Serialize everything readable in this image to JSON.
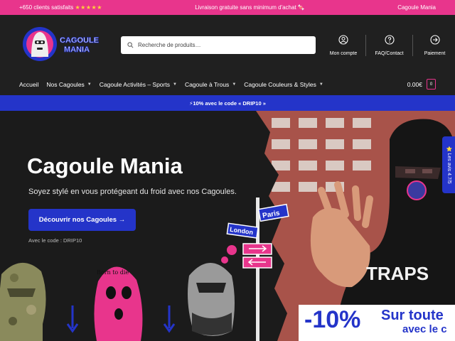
{
  "topbar": {
    "left_text": "+650 clients satisfaits",
    "stars": "★★★★★",
    "center_text": "Livraison gratuite sans minimum d'achat 🍬",
    "right_text": "Cagoule Mania"
  },
  "header": {
    "logo_text_line1": "CAGOULE",
    "logo_text_line2": "MANIA",
    "search_placeholder": "Recherche de produits…",
    "icons": [
      {
        "label": "Mon compte",
        "icon": "user-icon"
      },
      {
        "label": "FAQ/Contact",
        "icon": "help-icon"
      },
      {
        "label": "Paiement",
        "icon": "arrow-right-circle-icon"
      }
    ]
  },
  "nav": {
    "items": [
      {
        "label": "Accueil",
        "has_dropdown": false
      },
      {
        "label": "Nos Cagoules",
        "has_dropdown": true
      },
      {
        "label": "Cagoule Activités – Sports",
        "has_dropdown": true
      },
      {
        "label": "Cagoule à Trous",
        "has_dropdown": true
      },
      {
        "label": "Cagoule Couleurs & Styles",
        "has_dropdown": true
      }
    ],
    "cart_total": "0.00€",
    "cart_count": "0"
  },
  "promo": {
    "text": "⚡10% avec le code « DRIP10 »"
  },
  "hero": {
    "title": "Cagoule Mania",
    "subtitle": "Soyez stylé en vous protégeant du froid avec nos Cagoules.",
    "button_label": "Découvrir nos Cagoules →",
    "code_text": "Avec le code : DRIP10",
    "sign_paris": "Paris",
    "sign_london": "London",
    "balaclava_text": "Born to die",
    "shirt_text": "TRAPS",
    "review_tab": "⭐ Les avis 4.7/5"
  },
  "banner": {
    "percent": "-10%",
    "line1": "Sur toute",
    "line2": "avec le c"
  },
  "colors": {
    "topbar": "#e8358c",
    "accent": "#2434c9",
    "dark": "#202020"
  }
}
